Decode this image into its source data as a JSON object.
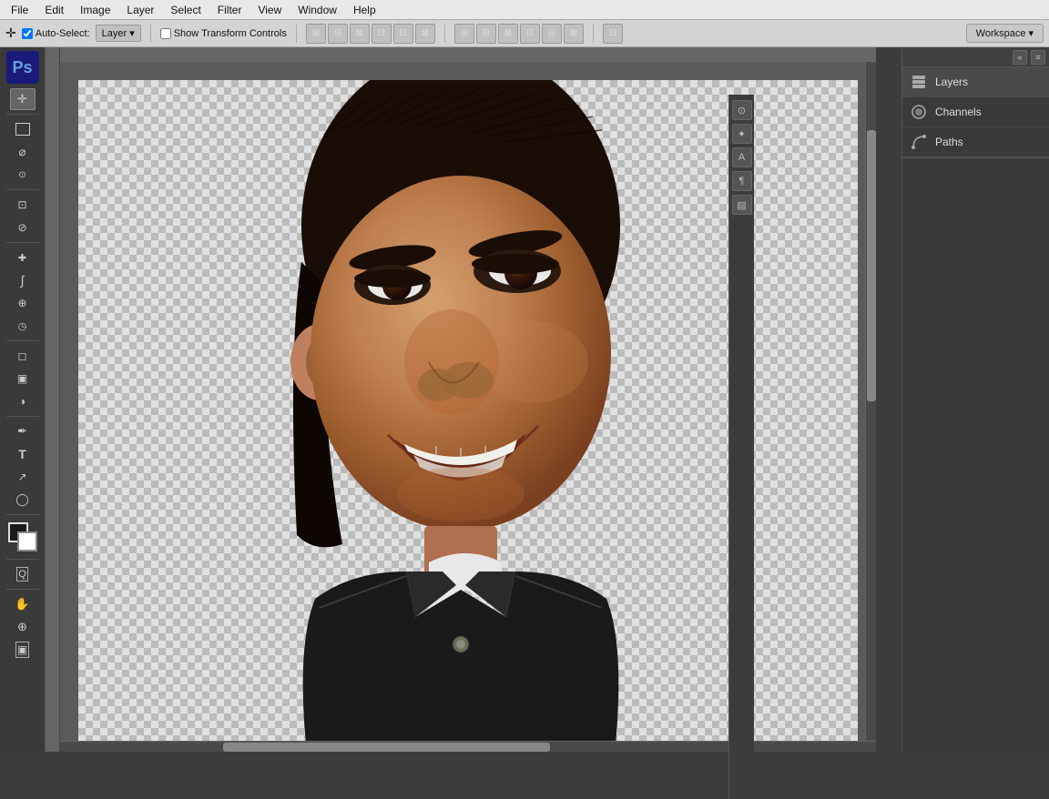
{
  "app": {
    "name": "Adobe Photoshop",
    "ps_logo": "Ps"
  },
  "menu": {
    "items": [
      "File",
      "Edit",
      "Image",
      "Layer",
      "Select",
      "Filter",
      "View",
      "Window",
      "Help"
    ]
  },
  "options_bar": {
    "tool_label": "Auto-Select:",
    "tool_value": "Layer",
    "show_transform_label": "Show Transform Controls",
    "workspace_label": "Workspace",
    "workspace_arrow": "▾"
  },
  "toolbar": {
    "tools": [
      {
        "name": "move-tool",
        "icon": "✛",
        "label": "Move"
      },
      {
        "name": "selection-tool",
        "icon": "⬚",
        "label": "Rectangular Marquee"
      },
      {
        "name": "lasso-tool",
        "icon": "⌀",
        "label": "Lasso"
      },
      {
        "name": "quick-select-tool",
        "icon": "✦",
        "label": "Quick Selection"
      },
      {
        "name": "crop-tool",
        "icon": "⊡",
        "label": "Crop"
      },
      {
        "name": "eyedropper-tool",
        "icon": "✏",
        "label": "Eyedropper"
      },
      {
        "name": "healing-tool",
        "icon": "✚",
        "label": "Healing Brush"
      },
      {
        "name": "brush-tool",
        "icon": "∫",
        "label": "Brush"
      },
      {
        "name": "clone-tool",
        "icon": "⊕",
        "label": "Clone Stamp"
      },
      {
        "name": "history-tool",
        "icon": "◷",
        "label": "History Brush"
      },
      {
        "name": "eraser-tool",
        "icon": "◻",
        "label": "Eraser"
      },
      {
        "name": "gradient-tool",
        "icon": "▣",
        "label": "Gradient"
      },
      {
        "name": "dodge-tool",
        "icon": "◑",
        "label": "Dodge"
      },
      {
        "name": "pen-tool",
        "icon": "✒",
        "label": "Pen"
      },
      {
        "name": "type-tool",
        "icon": "T",
        "label": "Type"
      },
      {
        "name": "path-select-tool",
        "icon": "↗",
        "label": "Path Selection"
      },
      {
        "name": "shape-tool",
        "icon": "◯",
        "label": "Shape"
      },
      {
        "name": "hand-tool",
        "icon": "✋",
        "label": "Hand"
      },
      {
        "name": "zoom-tool",
        "icon": "🔍",
        "label": "Zoom"
      }
    ],
    "fg_color": "#1a1a1a",
    "bg_color": "#ffffff"
  },
  "right_panel": {
    "tabs": [
      {
        "name": "layers-tab",
        "icon": "▦",
        "label": "Layers",
        "active": true
      },
      {
        "name": "channels-tab",
        "icon": "◉",
        "label": "Channels",
        "active": false
      },
      {
        "name": "paths-tab",
        "icon": "⟲",
        "label": "Paths",
        "active": false
      }
    ],
    "side_icons": [
      {
        "name": "adjust-icon",
        "icon": "⊙"
      },
      {
        "name": "style-icon",
        "icon": "✦"
      },
      {
        "name": "text-icon",
        "icon": "A"
      },
      {
        "name": "para-icon",
        "icon": "¶"
      },
      {
        "name": "history-panel-icon",
        "icon": "▤"
      }
    ]
  },
  "canvas": {
    "has_image": true,
    "image_description": "Caricature of a smiling person"
  }
}
